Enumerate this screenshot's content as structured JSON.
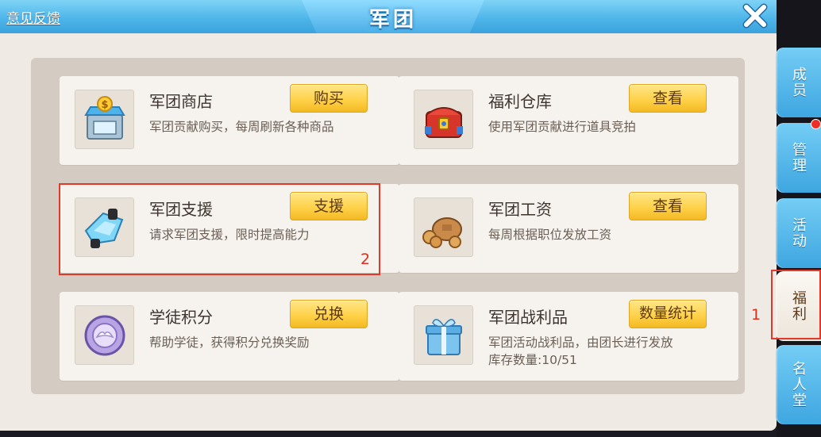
{
  "window": {
    "title": "军团",
    "feedback_link": "意见反馈",
    "close_icon": "close-icon"
  },
  "cards": [
    {
      "title": "军团商店",
      "desc": "军团贡献购买，每周刷新各种商品",
      "button": "购买",
      "icon": "shop-icon"
    },
    {
      "title": "福利仓库",
      "desc": "使用军团贡献进行道具竞拍",
      "button": "查看",
      "icon": "treasure-chest-icon"
    },
    {
      "title": "军团支援",
      "desc": "请求军团支援，限时提高能力",
      "button": "支援",
      "icon": "crystal-glove-icon"
    },
    {
      "title": "军团工资",
      "desc": "每周根据职位发放工资",
      "button": "查看",
      "icon": "coin-bag-icon"
    },
    {
      "title": "学徒积分",
      "desc": "帮助学徒，获得积分兑换奖励",
      "button": "兑换",
      "icon": "winged-badge-icon"
    },
    {
      "title": "军团战利品",
      "desc": "军团活动战利品，由团长进行发放",
      "desc2": "库存数量:10/51",
      "button": "数量统计",
      "icon": "gift-box-icon"
    }
  ],
  "side_tabs": [
    {
      "label": "成员",
      "active": false
    },
    {
      "label": "管理",
      "active": false,
      "badge": true
    },
    {
      "label": "活动",
      "active": false
    },
    {
      "label": "福利",
      "active": true
    },
    {
      "label": "名人堂",
      "active": false
    }
  ],
  "annotations": {
    "marker_1": "1",
    "marker_2": "2"
  },
  "colors": {
    "title_bar": "#4fb6ea",
    "button_gold": "#ffd24a",
    "highlight_red": "#e23a2a",
    "panel_bg": "#d4ccc3"
  }
}
